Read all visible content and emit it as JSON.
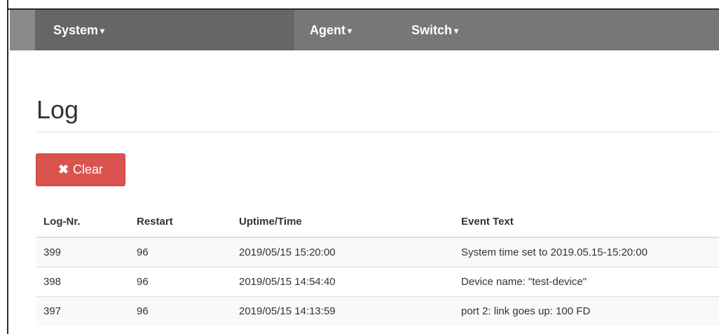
{
  "nav": {
    "items": [
      {
        "label": "System",
        "caret": "▾"
      },
      {
        "label": "Agent",
        "caret": "▾"
      },
      {
        "label": "Switch",
        "caret": "▾"
      }
    ]
  },
  "page": {
    "title": "Log"
  },
  "toolbar": {
    "clear_label": "Clear",
    "clear_icon": "✖"
  },
  "table": {
    "headers": [
      "Log-Nr.",
      "Restart",
      "Uptime/Time",
      "Event Text"
    ],
    "rows": [
      [
        "399",
        "96",
        "2019/05/15 15:20:00",
        "System time set to 2019.05.15-15:20:00"
      ],
      [
        "398",
        "96",
        "2019/05/15 14:54:40",
        "Device name: \"test-device\""
      ],
      [
        "397",
        "96",
        "2019/05/15 14:13:59",
        "port 2: link goes up: 100 FD"
      ]
    ]
  },
  "colors": {
    "navbar": "#777777",
    "danger": "#d9534f",
    "stripe": "#f9f9f9"
  }
}
